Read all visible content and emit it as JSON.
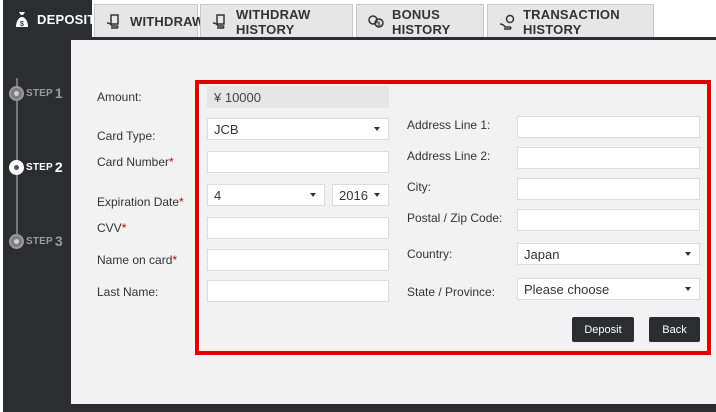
{
  "tabs": [
    {
      "label": "DEPOSIT",
      "icon": "money-bag-icon",
      "active": true
    },
    {
      "label": "WITHDRAW",
      "icon": "hand-money-icon"
    },
    {
      "label": "WITHDRAW HISTORY",
      "icon": "hand-money-icon"
    },
    {
      "label": "BONUS HISTORY",
      "icon": "coins-icon"
    },
    {
      "label": "TRANSACTION HISTORY",
      "icon": "hand-cash-icon"
    }
  ],
  "steps": [
    {
      "label": "STEP",
      "num": "1"
    },
    {
      "label": "STEP",
      "num": "2",
      "active": true
    },
    {
      "label": "STEP",
      "num": "3"
    }
  ],
  "form": {
    "amount_label": "Amount:",
    "amount_value": "¥ 10000",
    "card_type_label": "Card Type:",
    "card_type_value": "JCB",
    "card_number_label": "Card Number",
    "expiration_label": "Expiration Date",
    "exp_month_value": "4",
    "exp_year_value": "2016",
    "cvv_label": "CVV",
    "name_on_card_label": "Name on card",
    "last_name_label": "Last Name:",
    "required_mark": "*",
    "address1_label": "Address Line 1:",
    "address2_label": "Address Line 2:",
    "city_label": "City:",
    "postal_label": "Postal / Zip Code:",
    "country_label": "Country:",
    "country_value": "Japan",
    "state_label": "State / Province:",
    "state_value": "Please choose",
    "deposit_button": "Deposit",
    "back_button": "Back"
  },
  "colors": {
    "dark": "#2b2d30",
    "highlight": "#e00000",
    "required": "#cc0000"
  }
}
